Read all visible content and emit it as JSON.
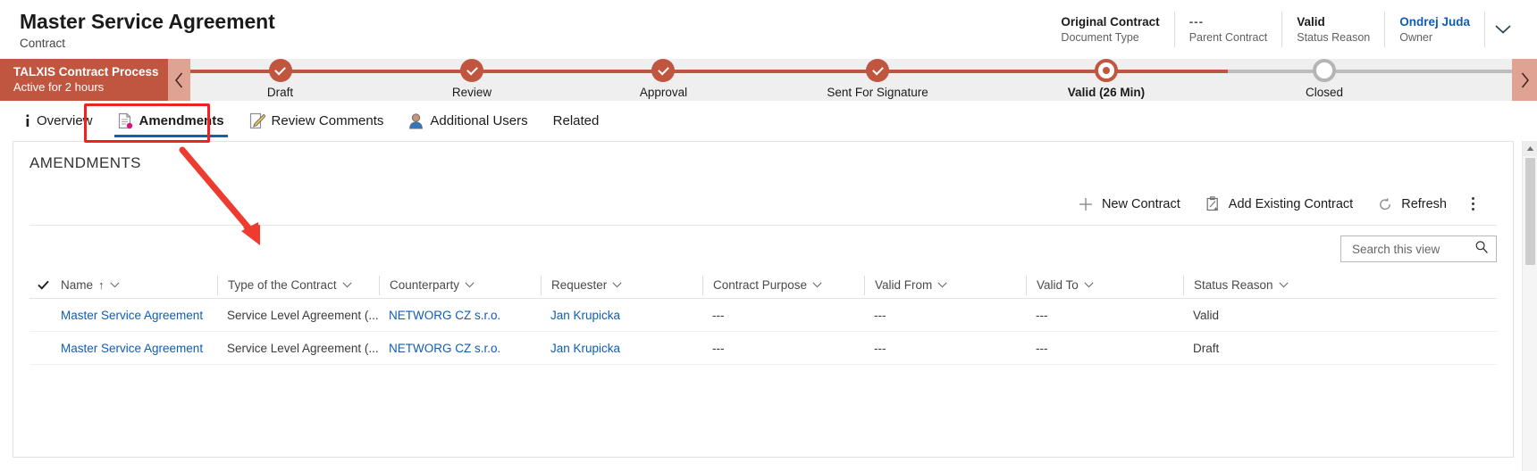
{
  "header": {
    "title": "Master Service Agreement",
    "subtitle": "Contract",
    "fields": [
      {
        "value": "Original Contract",
        "label": "Document Type",
        "kind": "text"
      },
      {
        "value": "---",
        "label": "Parent Contract",
        "kind": "dim"
      },
      {
        "value": "Valid",
        "label": "Status Reason",
        "kind": "text"
      },
      {
        "value": "Ondrej Juda",
        "label": "Owner",
        "kind": "link"
      }
    ],
    "expand_icon": "chevron-down-icon"
  },
  "process_flow": {
    "name": "TALXIS Contract Process",
    "status": "Active for 2 hours",
    "prev_icon": "chevron-left-icon",
    "next_icon": "chevron-right-icon",
    "accent_color": "#c15640",
    "stages": [
      {
        "label": "Draft",
        "state": "done"
      },
      {
        "label": "Review",
        "state": "done"
      },
      {
        "label": "Approval",
        "state": "done"
      },
      {
        "label": "Sent For Signature",
        "state": "done"
      },
      {
        "label": "Valid  (26 Min)",
        "state": "active"
      },
      {
        "label": "Closed",
        "state": "future"
      }
    ]
  },
  "tabs": [
    {
      "label": "Overview",
      "icon": "info-icon",
      "selected": false
    },
    {
      "label": "Amendments",
      "icon": "document-amend-icon",
      "selected": true
    },
    {
      "label": "Review Comments",
      "icon": "note-edit-icon",
      "selected": false
    },
    {
      "label": "Additional Users",
      "icon": "person-icon",
      "selected": false
    },
    {
      "label": "Related",
      "icon": "none",
      "selected": false
    }
  ],
  "annotation": {
    "highlight_color": "#ee2222",
    "arrow_color": "#ee3b2f",
    "target": "Amendments"
  },
  "panel": {
    "title": "AMENDMENTS",
    "commands": [
      {
        "label": "New Contract",
        "icon": "plus-icon"
      },
      {
        "label": "Add Existing Contract",
        "icon": "add-existing-icon"
      },
      {
        "label": "Refresh",
        "icon": "refresh-icon"
      }
    ],
    "more_icon": "more-vertical-icon",
    "search": {
      "placeholder": "Search this view",
      "value": "",
      "icon": "search-icon"
    }
  },
  "grid": {
    "select_all_icon": "checkmark-icon",
    "columns": [
      {
        "label": "Name",
        "sort": "↑",
        "width_class": "w-name"
      },
      {
        "label": "Type of the Contract",
        "sort": "",
        "width_class": "w-type"
      },
      {
        "label": "Counterparty",
        "sort": "",
        "width_class": "w-cpty"
      },
      {
        "label": "Requester",
        "sort": "",
        "width_class": "w-req"
      },
      {
        "label": "Contract Purpose",
        "sort": "",
        "width_class": "w-purp"
      },
      {
        "label": "Valid From",
        "sort": "",
        "width_class": "w-vfrom"
      },
      {
        "label": "Valid To",
        "sort": "",
        "width_class": "w-vto"
      },
      {
        "label": "Status Reason",
        "sort": "",
        "width_class": "w-stat"
      }
    ],
    "rows": [
      {
        "name": "Master Service Agreement",
        "type": "Service Level Agreement (...",
        "counterparty": "NETWORG CZ s.r.o.",
        "requester": "Jan Krupicka",
        "purpose": "---",
        "valid_from": "---",
        "valid_to": "---",
        "status": "Valid"
      },
      {
        "name": "Master Service Agreement",
        "type": "Service Level Agreement (...",
        "counterparty": "NETWORG CZ s.r.o.",
        "requester": "Jan Krupicka",
        "purpose": "---",
        "valid_from": "---",
        "valid_to": "---",
        "status": "Draft"
      }
    ]
  },
  "scrollbar": {
    "up_icon": "caret-up-icon",
    "down_icon": "caret-down-icon"
  }
}
